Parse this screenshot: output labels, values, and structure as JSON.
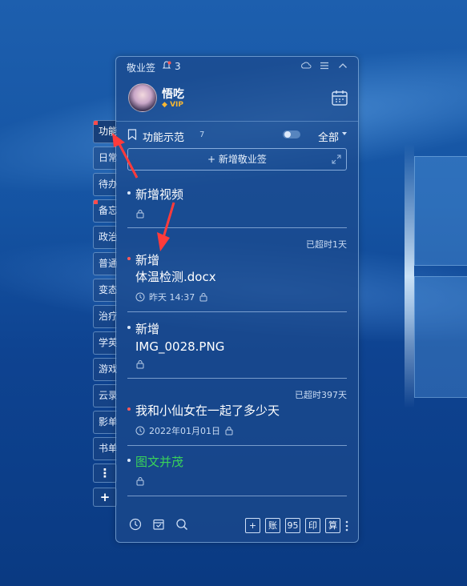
{
  "topbar": {
    "app_title": "敬业签",
    "notification_count": "3"
  },
  "user": {
    "name": "悟吃",
    "badge": "VIP"
  },
  "filter": {
    "label": "功能示范",
    "count": "7",
    "scope": "全部"
  },
  "add_button": {
    "label": "新增敬业签"
  },
  "side_tabs": [
    {
      "label": "功能",
      "active": true,
      "dot": true
    },
    {
      "label": "日常"
    },
    {
      "label": "待办"
    },
    {
      "label": "备忘",
      "dot": true
    },
    {
      "label": "政治"
    },
    {
      "label": "普通"
    },
    {
      "label": "变态"
    },
    {
      "label": "治疗"
    },
    {
      "label": "学英"
    },
    {
      "label": "游戏"
    },
    {
      "label": "云录"
    },
    {
      "label": "影单"
    },
    {
      "label": "书单"
    }
  ],
  "side_buttons": {
    "more": "⋮",
    "add": "+"
  },
  "notes": [
    {
      "title": "新增视频",
      "overdue": "",
      "meta": ""
    },
    {
      "title_line1": "新增",
      "title_line2": "体温检测.docx",
      "overdue": "已超时1天",
      "meta": "昨天 14:37"
    },
    {
      "title_line1": "新增",
      "title_line2": "IMG_0028.PNG",
      "overdue": "",
      "meta": ""
    },
    {
      "title": "我和小仙女在一起了多少天",
      "overdue": "已超时397天",
      "meta": "2022年01月01日"
    },
    {
      "title": "图文并茂",
      "overdue": "",
      "meta": ""
    }
  ],
  "bottombar": {
    "btn_add": "+",
    "btn_account": "账",
    "btn_95": "95",
    "btn_print": "印",
    "btn_calc": "算"
  },
  "colors": {
    "overdue_dot": "#ff5a5a",
    "green_title": "#39d25a",
    "vip": "#f7b733",
    "arrow": "#ff3b3b"
  }
}
